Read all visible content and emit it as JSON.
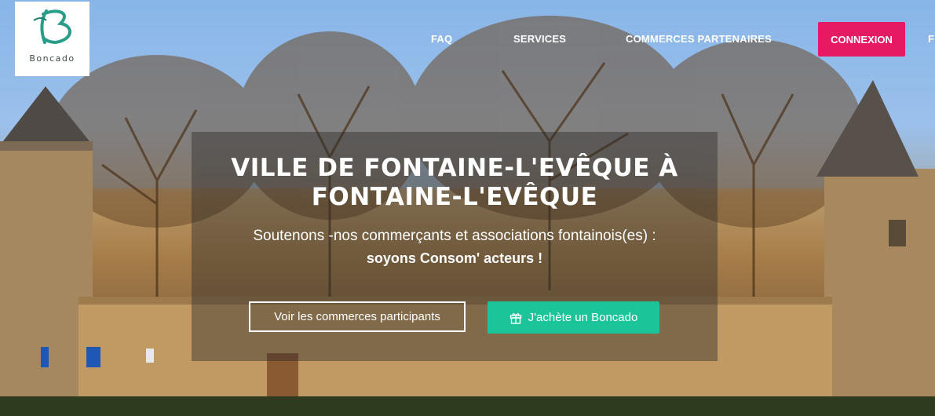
{
  "brand": {
    "name": "Boncado",
    "logo_word": "BONCADO"
  },
  "nav": {
    "items": [
      "FAQ",
      "SERVICES",
      "COMMERCES PARTENAIRES"
    ],
    "login": "CONNEXION",
    "overflow": "F"
  },
  "hero": {
    "title": "VILLE DE FONTAINE-L'EVÊQUE À FONTAINE-L'EVÊQUE",
    "subtitle": "Soutenons -nos commerçants et associations fontainois(es) :",
    "tagline": "soyons Consom' acteurs !",
    "btn_browse": "Voir les commerces participants",
    "btn_buy": "J'achète un Boncado"
  },
  "colors": {
    "login_button": "#e61a63",
    "buy_button": "#1cc49a",
    "logo_green": "#2a9d8a"
  },
  "icons": {
    "gift": "gift-icon"
  }
}
